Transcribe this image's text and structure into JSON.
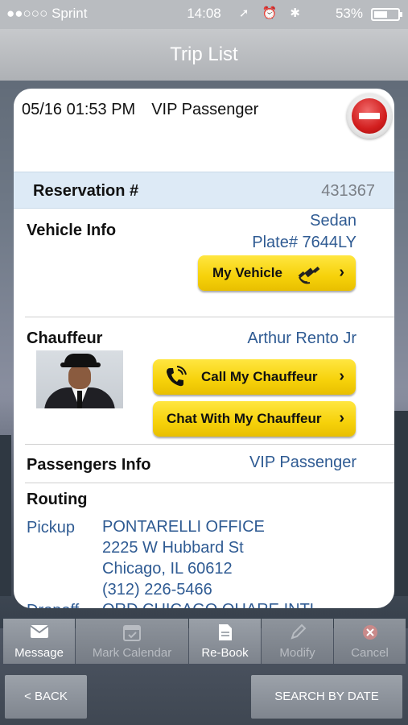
{
  "status_bar": {
    "carrier": "●●○○○ Sprint",
    "time": "14:08",
    "battery": "53%"
  },
  "header": {
    "title": "Trip List"
  },
  "trip": {
    "datetime": "05/16 01:53 PM",
    "passenger_type": "VIP Passenger",
    "reservation_label": "Reservation #",
    "reservation_number": "431367",
    "vehicle_label": "Vehicle Info",
    "vehicle_type": "Sedan",
    "plate": "Plate# 7644LY",
    "my_vehicle_button": "My Vehicle",
    "chauffeur_label": "Chauffeur",
    "chauffeur_name": "Arthur Rento Jr",
    "call_button": "Call My Chauffeur",
    "chat_button": "Chat With My Chauffeur",
    "passengers_label": "Passengers Info",
    "passengers_value": "VIP Passenger",
    "routing_label": "Routing",
    "pickup_label": "Pickup",
    "pickup_name": "PONTARELLI OFFICE",
    "pickup_street": "2225 W Hubbard St",
    "pickup_city": "Chicago, IL 60612",
    "pickup_phone": "(312) 226-5466",
    "dropoff_label": "Dropoff",
    "dropoff_name": "ORD CHICAGO OHARE INTL"
  },
  "tabs": [
    {
      "label": "Message",
      "icon": "envelope-icon",
      "enabled": true
    },
    {
      "label": "Mark Calendar",
      "icon": "calendar-icon",
      "enabled": false
    },
    {
      "label": "Re-Book",
      "icon": "document-icon",
      "enabled": true
    },
    {
      "label": "Modify",
      "icon": "pencil-icon",
      "enabled": false
    },
    {
      "label": "Cancel",
      "icon": "cancel-icon",
      "enabled": false
    }
  ],
  "footer": {
    "back": "< BACK",
    "search_by_date": "SEARCH BY DATE"
  },
  "colors": {
    "accent_blue": "#2f5b93",
    "button_yellow": "#f6d10a",
    "cancel_red": "#d21e1e",
    "reservation_bg": "#ddeaf6"
  }
}
